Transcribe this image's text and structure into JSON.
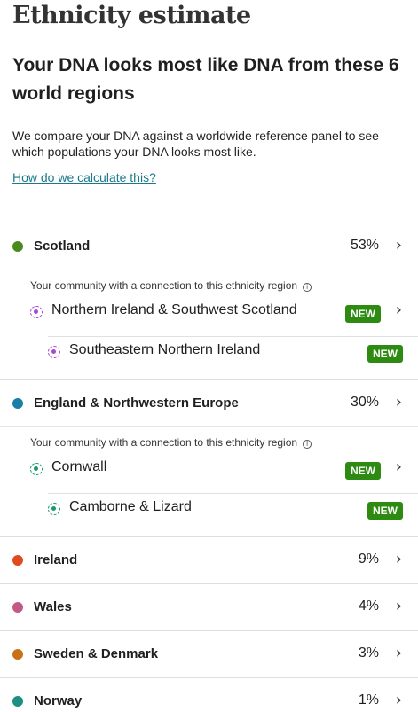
{
  "page_title": "Ethnicity estimate",
  "headline": "Your DNA looks most like DNA from these 6 world regions",
  "description": "We compare your DNA against a worldwide reference panel to see which populations your DNA looks most like.",
  "calc_link": "How do we calculate this?",
  "community_label": "Your community with a connection to this ethnicity region",
  "badge_label": "NEW",
  "colors": {
    "scotland": "#4a8a1c",
    "england": "#1a7ea5",
    "ireland": "#e04a1f",
    "wales": "#c35a85",
    "sweden": "#c87214",
    "norway": "#1a9080",
    "nirl_ring": "#a64bd1",
    "cornwall_ring": "#1a9a6a",
    "badge": "#2e8b12"
  },
  "regions": [
    {
      "name": "Scotland",
      "percent": "53%",
      "icon": "chevron-right-icon"
    },
    {
      "name": "England & Northwestern Europe",
      "percent": "30%",
      "icon": "chevron-right-icon"
    },
    {
      "name": "Ireland",
      "percent": "9%",
      "icon": "chevron-right-icon"
    },
    {
      "name": "Wales",
      "percent": "4%",
      "icon": "chevron-right-icon"
    },
    {
      "name": "Sweden & Denmark",
      "percent": "3%",
      "icon": "chevron-right-icon"
    },
    {
      "name": "Norway",
      "percent": "1%",
      "icon": "chevron-right-icon"
    }
  ],
  "communities": {
    "scotland": {
      "primary": "Northern Ireland & Southwest Scotland",
      "secondary": "Southeastern Northern Ireland"
    },
    "england": {
      "primary": "Cornwall",
      "secondary": "Camborne & Lizard"
    }
  }
}
